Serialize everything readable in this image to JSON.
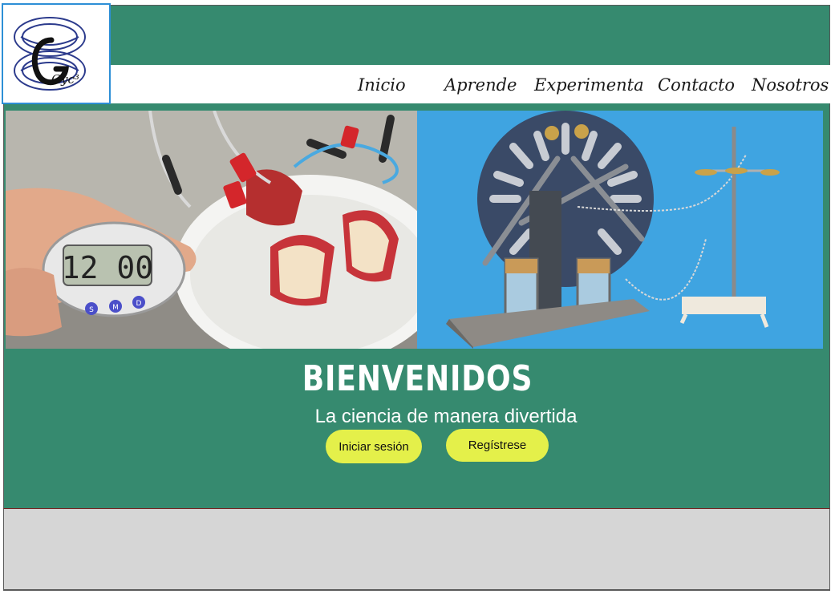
{
  "brand": {
    "logo_text": "Gyc³"
  },
  "nav": {
    "items": [
      {
        "label": "Inicio"
      },
      {
        "label": "Aprende"
      },
      {
        "label": "Experimenta"
      },
      {
        "label": "Contacto"
      },
      {
        "label": "Nosotros"
      }
    ]
  },
  "hero": {
    "timer_display": "12 00",
    "timer_buttons": [
      "S",
      "M",
      "D"
    ]
  },
  "welcome": {
    "title": "BIENVENIDOS",
    "subtitle": "La ciencia de manera divertida",
    "login_label": "Iniciar sesión",
    "register_label": "Regístrese"
  },
  "colors": {
    "brand_green": "#368a6f",
    "button_yellow": "#e4f04a",
    "footer_gray": "#d6d6d6",
    "logo_border": "#2d8fd6"
  }
}
